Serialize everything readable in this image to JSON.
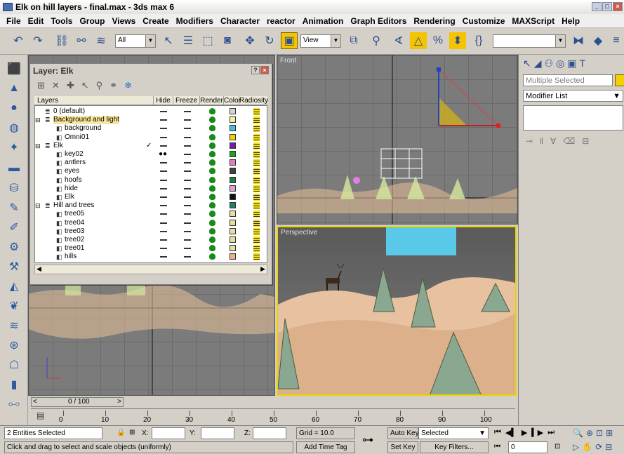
{
  "app": {
    "title": "Elk on hill layers - final.max - 3ds max 6"
  },
  "menu": [
    "File",
    "Edit",
    "Tools",
    "Group",
    "Views",
    "Create",
    "Modifiers",
    "Character",
    "reactor",
    "Animation",
    "Graph Editors",
    "Rendering",
    "Customize",
    "MAXScript",
    "Help"
  ],
  "toolbar": {
    "selection_filter": "All",
    "ref_coord": "View",
    "named_sel": ""
  },
  "layer_window": {
    "title": "Layer: Elk",
    "columns": [
      "Layers",
      "Hide",
      "Freeze",
      "Render",
      "Color",
      "Radiosity"
    ],
    "rows": [
      {
        "name": "0 (default)",
        "indent": 0,
        "type": "layer",
        "color": "#d4d4d4",
        "selected": false
      },
      {
        "name": "Background and light",
        "indent": 0,
        "type": "layer",
        "color": "#f0f0a0",
        "selected": true,
        "expanded": true
      },
      {
        "name": "background",
        "indent": 1,
        "type": "object",
        "color": "#40c0e0"
      },
      {
        "name": "Omni01",
        "indent": 1,
        "type": "object",
        "color": "#f0d000"
      },
      {
        "name": "Elk",
        "indent": 0,
        "type": "layer",
        "color": "#7a1aa0",
        "expanded": true,
        "current": true
      },
      {
        "name": "key02",
        "indent": 1,
        "type": "object",
        "color": "#20a020",
        "hidden_glyph": true
      },
      {
        "name": "antlers",
        "indent": 1,
        "type": "object",
        "color": "#e080c0"
      },
      {
        "name": "eyes",
        "indent": 1,
        "type": "object",
        "color": "#404040"
      },
      {
        "name": "hoofs",
        "indent": 1,
        "type": "object",
        "color": "#208040"
      },
      {
        "name": "hide",
        "indent": 1,
        "type": "object",
        "color": "#e0a0d0"
      },
      {
        "name": "Elk",
        "indent": 1,
        "type": "object",
        "color": "#101010"
      },
      {
        "name": "Hill and trees",
        "indent": 0,
        "type": "layer",
        "color": "#208060",
        "expanded": true
      },
      {
        "name": "tree05",
        "indent": 1,
        "type": "object",
        "color": "#e0e0a0"
      },
      {
        "name": "tree04",
        "indent": 1,
        "type": "object",
        "color": "#e0e0a0"
      },
      {
        "name": "tree03",
        "indent": 1,
        "type": "object",
        "color": "#e0e0a0"
      },
      {
        "name": "tree02",
        "indent": 1,
        "type": "object",
        "color": "#e0e0a0"
      },
      {
        "name": "tree01",
        "indent": 1,
        "type": "object",
        "color": "#e0e0a0"
      },
      {
        "name": "hills",
        "indent": 1,
        "type": "object",
        "color": "#f0b090"
      }
    ]
  },
  "viewports": {
    "top_left": "",
    "front": "Front",
    "perspective": "Perspective"
  },
  "command_panel": {
    "name_field": "Multiple Selected",
    "modifier_list": "Modifier List"
  },
  "timeline": {
    "frame_slider": "0 / 100",
    "ticks": [
      "0",
      "10",
      "20",
      "30",
      "40",
      "50",
      "60",
      "70",
      "80",
      "90",
      "100"
    ]
  },
  "status": {
    "selection": "2 Entities Selected",
    "prompt": "Click and drag to select and scale objects (uniformly)",
    "x_label": "X:",
    "y_label": "Y:",
    "z_label": "Z:",
    "grid": "Grid = 10.0",
    "add_time_tag": "Add Time Tag",
    "auto_key": "Auto Key",
    "set_key": "Set Key",
    "key_mode": "Selected",
    "key_filters": "Key Filters...",
    "current_frame": "0"
  },
  "colors": {
    "viewport_bg": "#7b7b7b",
    "active_viewport_border": "#e8d400",
    "layer_highlight": "#f8e79e"
  }
}
